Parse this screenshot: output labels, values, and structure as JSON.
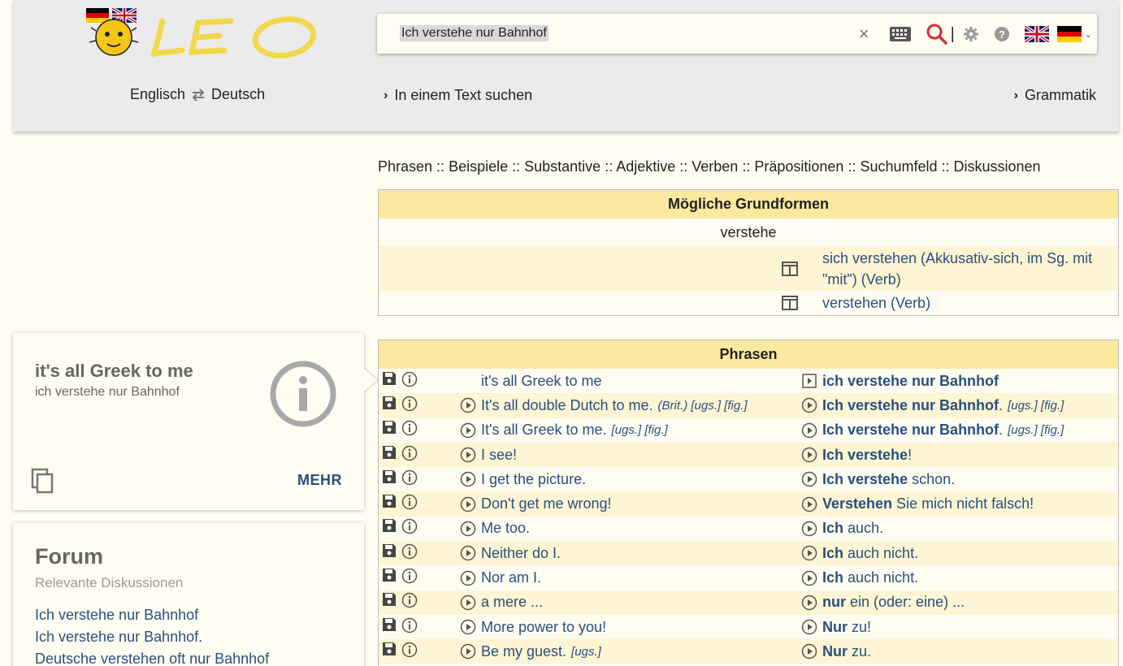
{
  "search": {
    "query": "Ich verstehe nur Bahnhof"
  },
  "header": {
    "lang_from": "Englisch",
    "lang_to": "Deutsch",
    "text_search": "In einem Text suchen",
    "grammar": "Grammatik"
  },
  "sections": [
    "Phrasen",
    "Beispiele",
    "Substantive",
    "Adjektive",
    "Verben",
    "Präpositionen",
    "Suchumfeld",
    "Diskussionen"
  ],
  "grundformen": {
    "title": "Mögliche Grundformen",
    "base": "verstehe",
    "items": [
      "sich verstehen (Akkusativ-sich, im Sg. mit \"mit\") (Verb)",
      "verstehen (Verb)"
    ]
  },
  "phrasen": {
    "title": "Phrasen",
    "rows": [
      {
        "en": "it's all Greek to me",
        "en_note": "",
        "de_head": "ich verstehe nur Bahnhof",
        "de_rest": "",
        "de_note": "",
        "en_play": false
      },
      {
        "en": "It's all double Dutch to me.",
        "en_note": "(Brit.) [ugs.] [fig.]",
        "de_head": "Ich verstehe nur Bahnhof",
        "de_rest": ".",
        "de_note": "[ugs.] [fig.]",
        "en_play": true
      },
      {
        "en": "It's all Greek to me.",
        "en_note": "[ugs.] [fig.]",
        "de_head": "Ich verstehe nur Bahnhof",
        "de_rest": ".",
        "de_note": "[ugs.] [fig.]",
        "en_play": true
      },
      {
        "en": "I see!",
        "en_note": "",
        "de_head": "Ich verstehe",
        "de_rest": "!",
        "de_note": "",
        "en_play": true
      },
      {
        "en": "I get the picture.",
        "en_note": "",
        "de_head": "Ich verstehe",
        "de_rest": " schon.",
        "de_note": "",
        "en_play": true
      },
      {
        "en": "Don't get me wrong!",
        "en_note": "",
        "de_head": "Verstehen",
        "de_rest": " Sie mich nicht falsch!",
        "de_note": "",
        "en_play": true
      },
      {
        "en": "Me too.",
        "en_note": "",
        "de_head": "Ich",
        "de_rest": " auch.",
        "de_note": "",
        "en_play": true
      },
      {
        "en": "Neither do I.",
        "en_note": "",
        "de_head": "Ich",
        "de_rest": " auch nicht.",
        "de_note": "",
        "en_play": true
      },
      {
        "en": "Nor am I.",
        "en_note": "",
        "de_head": "Ich",
        "de_rest": " auch nicht.",
        "de_note": "",
        "en_play": true
      },
      {
        "en": "a mere ...",
        "en_note": "",
        "de_head": "nur",
        "de_rest": " ein (oder: eine) ...",
        "de_note": "",
        "en_play": true
      },
      {
        "en": "More power to you!",
        "en_note": "",
        "de_head": "Nur",
        "de_rest": " zu!",
        "de_note": "",
        "en_play": true
      },
      {
        "en": "Be my guest.",
        "en_note": "[ugs.]",
        "de_head": "Nur",
        "de_rest": " zu.",
        "de_note": "",
        "en_play": true
      }
    ]
  },
  "card": {
    "title": "it's all Greek to me",
    "subtitle": "ich verstehe nur Bahnhof",
    "more": "MEHR"
  },
  "forum": {
    "title": "Forum",
    "subtitle": "Relevante Diskussionen",
    "links": [
      "Ich verstehe nur Bahnhof",
      "Ich verstehe nur Bahnhof.",
      "Deutsche verstehen oft nur Bahnhof"
    ]
  }
}
